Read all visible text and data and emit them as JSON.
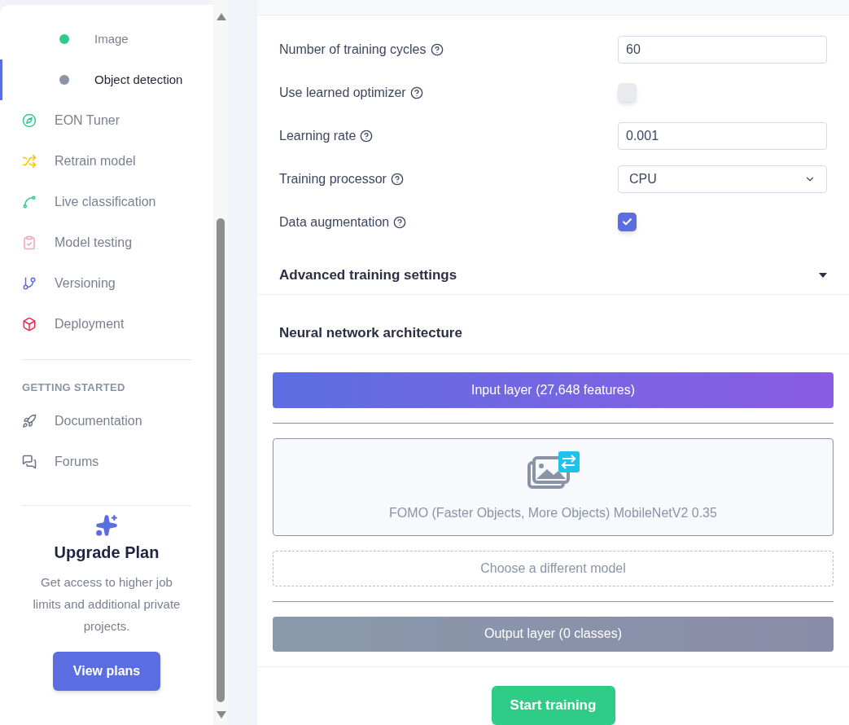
{
  "sidebar": {
    "sub_items": [
      {
        "label": "Image",
        "color": "#2ecc87",
        "selected": false
      },
      {
        "label": "Object detection",
        "color": "#8a94a6",
        "selected": true
      }
    ],
    "nav_items": [
      {
        "label": "EON Tuner",
        "kind": "compass"
      },
      {
        "label": "Retrain model",
        "kind": "shuffle"
      },
      {
        "label": "Live classification",
        "kind": "curve"
      },
      {
        "label": "Model testing",
        "kind": "clipboard"
      },
      {
        "label": "Versioning",
        "kind": "branch"
      },
      {
        "label": "Deployment",
        "kind": "box"
      }
    ],
    "section_heading": "GETTING STARTED",
    "help_items": [
      {
        "label": "Documentation",
        "kind": "rocket"
      },
      {
        "label": "Forums",
        "kind": "chat"
      }
    ],
    "upgrade": {
      "title": "Upgrade Plan",
      "text": "Get access to higher job limits and additional private projects.",
      "button": "View plans"
    }
  },
  "settings": [
    {
      "kind": "input",
      "label": "Number of training cycles",
      "value": "60"
    },
    {
      "kind": "checkbox",
      "label": "Use learned optimizer",
      "checked": false
    },
    {
      "kind": "input",
      "label": "Learning rate",
      "value": "0.001"
    },
    {
      "kind": "select",
      "label": "Training processor",
      "value": "CPU"
    },
    {
      "kind": "checkbox",
      "label": "Data augmentation",
      "checked": true
    }
  ],
  "advanced": {
    "label": "Advanced training settings",
    "expanded": false
  },
  "architecture": {
    "heading": "Neural network architecture",
    "input_layer": "Input layer (27,648 features)",
    "model": "FOMO (Faster Objects, More Objects) MobileNetV2 0.35",
    "choose": "Choose a different model",
    "output_layer": "Output layer (0 classes)"
  },
  "start_button": "Start training"
}
